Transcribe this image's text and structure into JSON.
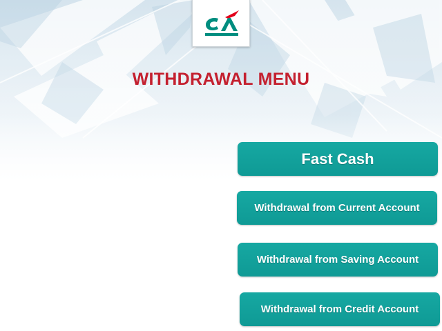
{
  "screen": {
    "title": "WITHDRAWAL MENU"
  },
  "logo": {
    "icon": "credit-agricole-logo",
    "text": "CA"
  },
  "menu": {
    "fast_cash": "Fast Cash",
    "current_account": "Withdrawal from Current Account",
    "saving_account": "Withdrawal from Saving Account",
    "credit_account": "Withdrawal from Credit Account"
  },
  "colors": {
    "title": "#c4202f",
    "button": "#13a19c",
    "logo_green": "#008d7f",
    "logo_red": "#e2001a"
  }
}
